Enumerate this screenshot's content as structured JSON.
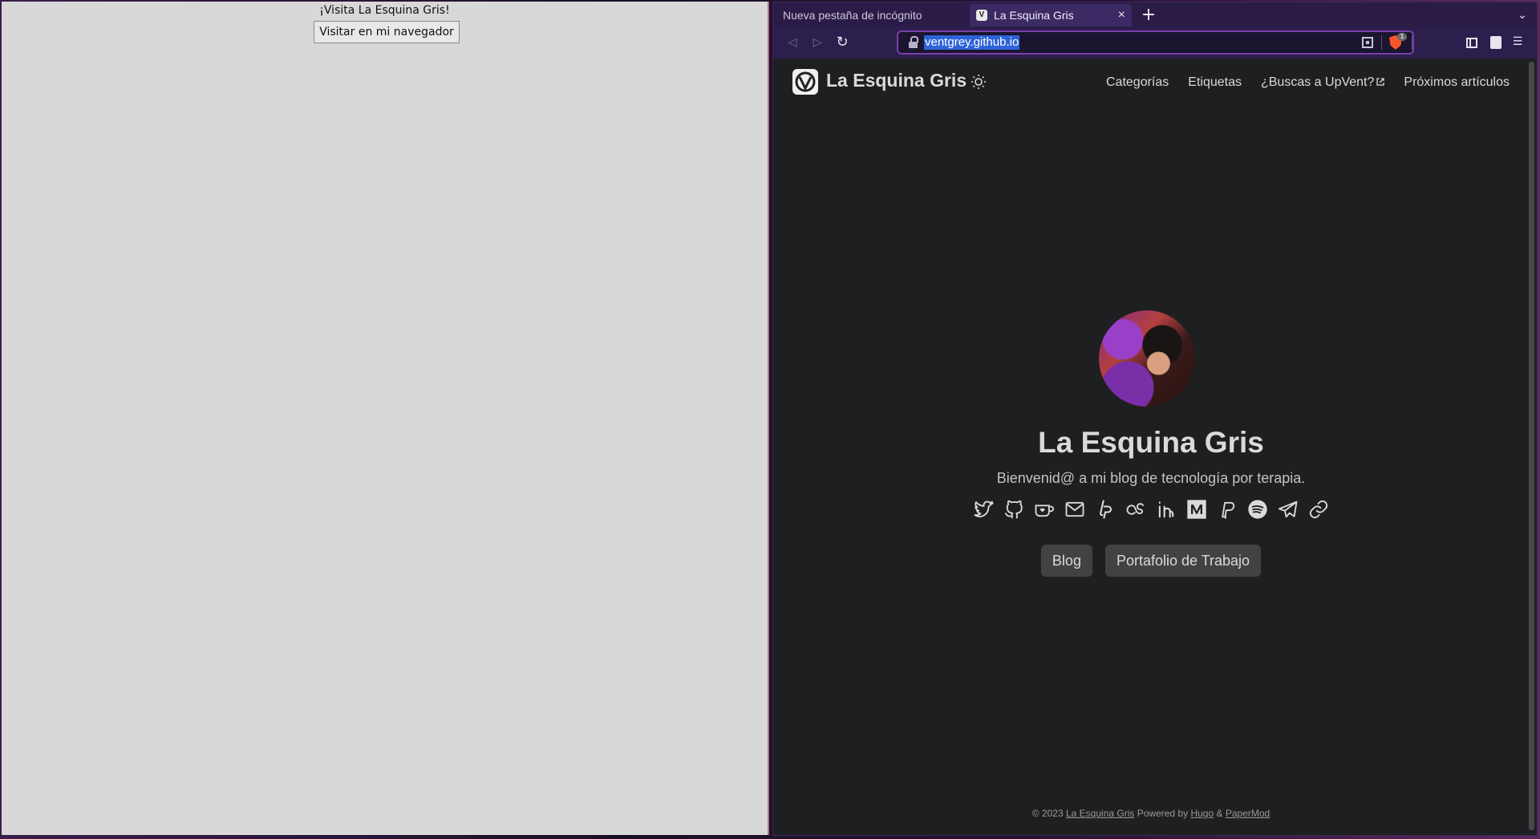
{
  "left_window": {
    "title": "¡Visita La Esquina Gris!",
    "button_label": "Visitar en mi navegador"
  },
  "browser": {
    "tabs": [
      {
        "label": "Nueva pestaña de incógnito",
        "active": false
      },
      {
        "label": "La Esquina Gris",
        "active": true
      }
    ],
    "new_tab_label": "+",
    "close_tab_label": "×",
    "url": "ventgrey.github.io",
    "shields_badge": "1",
    "accent_color": "#7a3fa8",
    "url_highlight_color": "#2d63d8"
  },
  "site": {
    "name": "La Esquina Gris",
    "nav": [
      {
        "label": "Categorías"
      },
      {
        "label": "Etiquetas"
      },
      {
        "label": "¿Buscas a UpVent?",
        "external": true
      },
      {
        "label": "Próximos artículos"
      }
    ],
    "profile_title": "La Esquina Gris",
    "profile_subtitle": "Bienvenid@ a mi blog de tecnología por terapia.",
    "social_icons": [
      "twitter-icon",
      "github-icon",
      "kofi-icon",
      "email-icon",
      "liberapay-icon",
      "lastfm-icon",
      "linkedin-icon",
      "medium-icon",
      "paypal-icon",
      "spotify-icon",
      "telegram-icon",
      "link-icon"
    ],
    "buttons": [
      {
        "label": "Blog"
      },
      {
        "label": "Portafolio de Trabajo"
      }
    ],
    "footer": {
      "copyright": "© 2023",
      "site_link": "La Esquina Gris",
      "powered_by": "Powered by",
      "hugo": "Hugo",
      "amp": "&",
      "papermod": "PaperMod"
    },
    "background_color": "#1e1f20",
    "text_color": "#dadadb"
  }
}
